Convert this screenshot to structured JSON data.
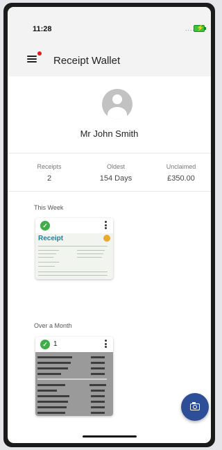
{
  "status_bar": {
    "time": "11:28",
    "signal": "....",
    "battery_icon": "battery-charging-icon"
  },
  "header": {
    "title": "Receipt Wallet",
    "menu_icon": "hamburger-menu-icon"
  },
  "profile": {
    "name": "Mr John Smith",
    "avatar_icon": "person-avatar-icon"
  },
  "stats": [
    {
      "label": "Receipts",
      "value": "2"
    },
    {
      "label": "Oldest",
      "value": "154 Days"
    },
    {
      "label": "Unclaimed",
      "value": "£350.00"
    }
  ],
  "sections": [
    {
      "heading": "This Week",
      "card": {
        "count": "",
        "thumbnail_title": "Receipt"
      }
    },
    {
      "heading": "Over a Month",
      "card": {
        "count": "1"
      }
    }
  ],
  "fab": {
    "icon": "camera-icon"
  },
  "colors": {
    "accent": "#2e4f97",
    "check_green": "#3fae49",
    "notification_dot": "#e01e1e"
  }
}
